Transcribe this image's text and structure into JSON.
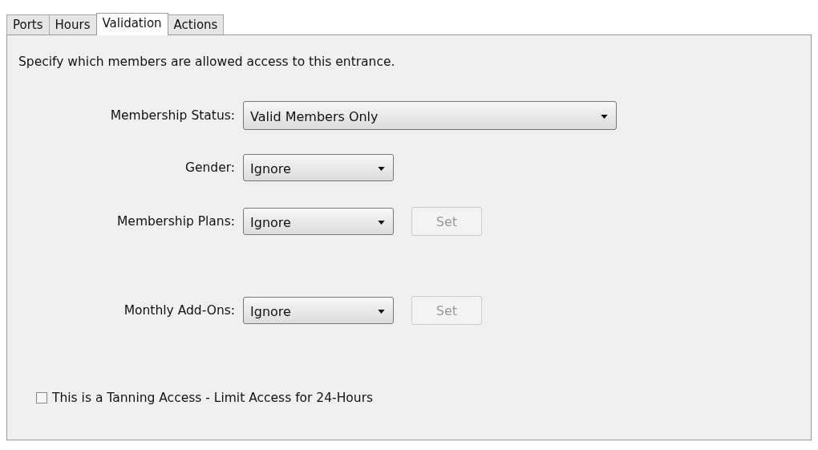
{
  "tabs": [
    {
      "label": "Ports",
      "selected": false
    },
    {
      "label": "Hours",
      "selected": false
    },
    {
      "label": "Validation",
      "selected": true
    },
    {
      "label": "Actions",
      "selected": false
    }
  ],
  "description": "Specify which members are allowed access to this entrance.",
  "fields": [
    {
      "label": "Membership Status:",
      "value": "Valid Members Only"
    },
    {
      "label": "Gender:",
      "value": "Ignore"
    },
    {
      "label": "Membership Plans:",
      "value": "Ignore",
      "button": {
        "label": "Set",
        "disabled": true
      }
    },
    {
      "label": "Monthly Add-Ons:",
      "value": "Ignore",
      "button": {
        "label": "Set",
        "disabled": true
      }
    }
  ],
  "tanning_checkbox": {
    "label": "This is a Tanning Access - Limit Access for 24-Hours",
    "checked": false
  }
}
